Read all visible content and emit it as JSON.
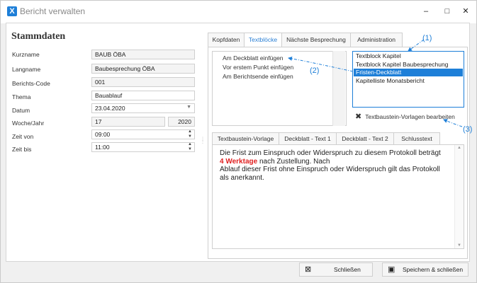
{
  "window": {
    "title": "Bericht verwalten",
    "app_icon_letter": "X",
    "minimize": "–",
    "maximize": "□",
    "close": "✕"
  },
  "stammdaten": {
    "heading": "Stammdaten",
    "fields": [
      {
        "label": "Kurzname",
        "value": "BAUB ÖBA"
      },
      {
        "label": "Langname",
        "value": "Baubesprechung ÖBA"
      },
      {
        "label": "Berichts-Code",
        "value": "001"
      },
      {
        "label": "Thema",
        "value": "Bauablauf"
      },
      {
        "label": "Datum",
        "value": "23.04.2020"
      },
      {
        "label": "Woche/Jahr",
        "value": "17",
        "value2": "2020"
      },
      {
        "label": "Zeit von",
        "value": "09:00"
      },
      {
        "label": "Zeit bis",
        "value": "11:00"
      }
    ]
  },
  "top_tabs": [
    "Kopfdaten",
    "Textblöcke",
    "Nächste Besprechung",
    "Administration"
  ],
  "insert_options": [
    "Am Deckblatt einfügen",
    "Vor erstem Punkt einfügen",
    "Am Berichtsende einfügen"
  ],
  "textblocks": [
    "Textblock Kapitel",
    "Textblock Kapitel Baubesprechung",
    "Fristen-Deckblatt",
    "Kapitelliste Monatsbericht"
  ],
  "edit_templates_button": "Textbaustein-Vorlagen bearbeiten",
  "sub_tabs": [
    "Textbaustein-Vorlage",
    "Deckblatt - Text 1",
    "Deckblatt - Text 2",
    "Schlusstext"
  ],
  "editor": {
    "line1": "Die Frist zum Einspruch oder Widerspruch zu diesem Protokoll beträgt",
    "highlight": "4 Werktage",
    "line2_rest": " nach Zustellung. Nach",
    "line3": "Ablauf dieser Frist ohne Einspruch oder Widerspruch gilt das Protokoll",
    "line4": "als anerkannt."
  },
  "footer": {
    "close_label": "Schließen",
    "save_close_label": "Speichern & schließen"
  },
  "annotations": [
    "(1)",
    "(2)",
    "(3)"
  ],
  "colors": {
    "accent": "#1e7fd8",
    "highlight_text": "#e02020"
  }
}
